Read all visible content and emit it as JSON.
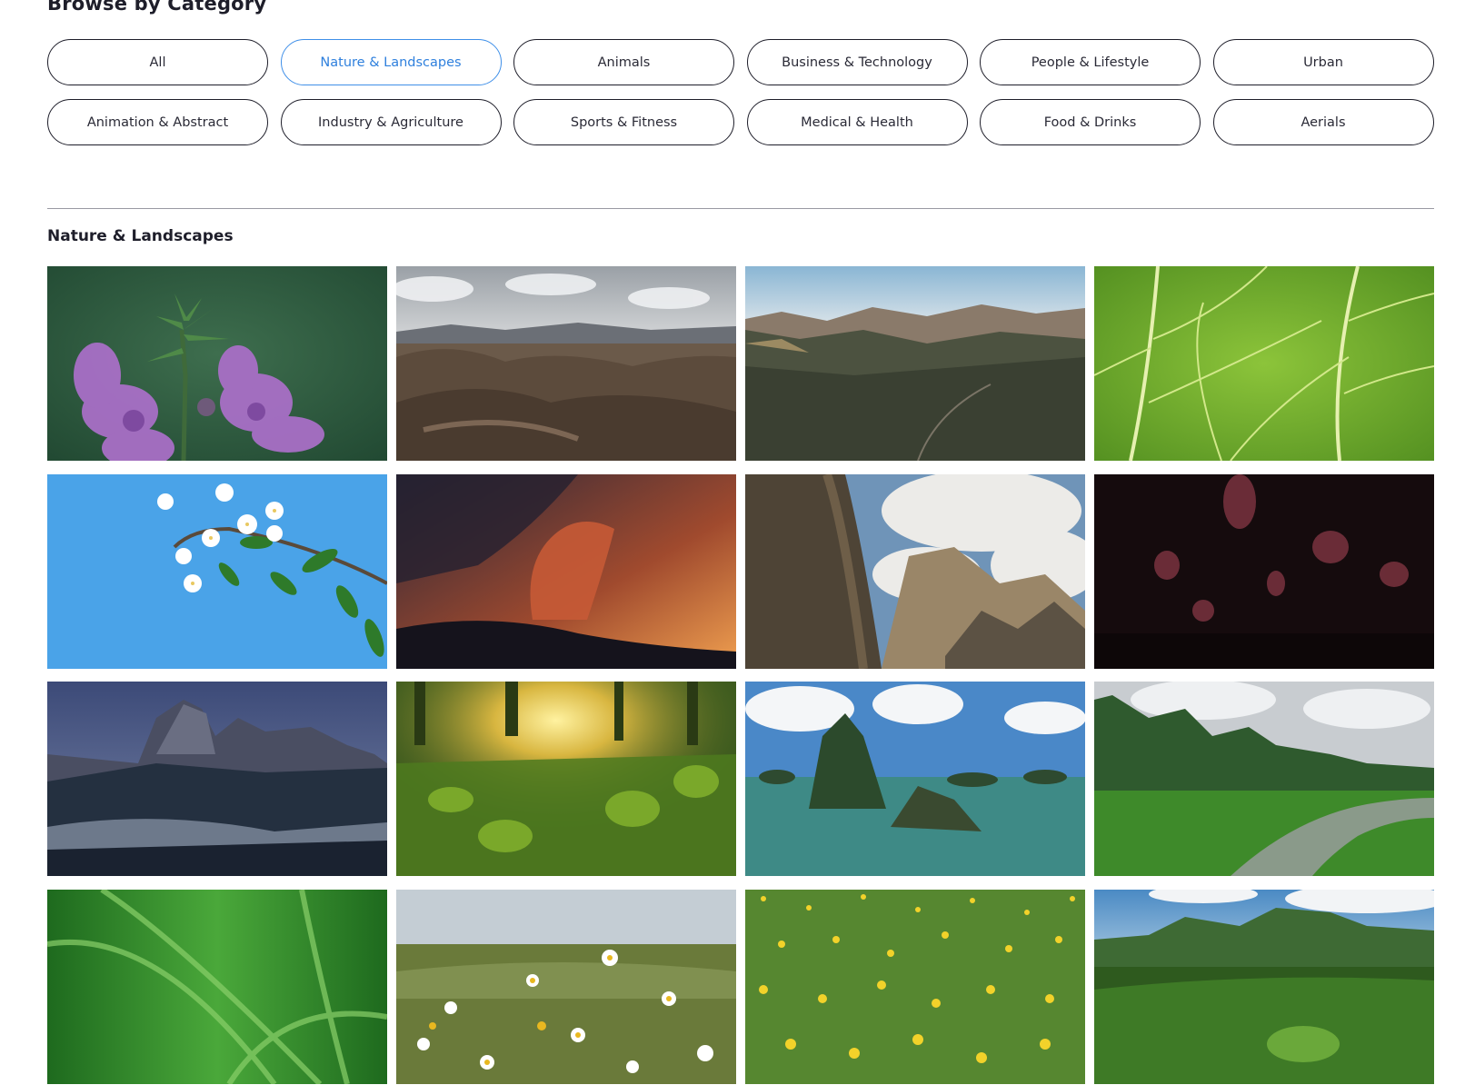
{
  "browse": {
    "heading": "Browse by Category",
    "categories": [
      {
        "label": "All"
      },
      {
        "label": "Nature & Landscapes",
        "active": true
      },
      {
        "label": "Animals"
      },
      {
        "label": "Business & Technology"
      },
      {
        "label": "People & Lifestyle"
      },
      {
        "label": "Urban"
      },
      {
        "label": "Animation & Abstract"
      },
      {
        "label": "Industry & Agriculture"
      },
      {
        "label": "Sports & Fitness"
      },
      {
        "label": "Medical & Health"
      },
      {
        "label": "Food & Drinks"
      },
      {
        "label": "Aerials"
      }
    ]
  },
  "section": {
    "title": "Nature & Landscapes"
  },
  "colors": {
    "accent": "#3f8fe8",
    "text": "#1e1e2a",
    "divider": "#9a9aa2"
  },
  "thumbnails": [
    {
      "name": "purple-flower-thumbnail"
    },
    {
      "name": "desert-rocks-thumbnail"
    },
    {
      "name": "mountain-valley-thumbnail"
    },
    {
      "name": "green-leaf-thumbnail"
    },
    {
      "name": "cherry-blossom-thumbnail"
    },
    {
      "name": "volcano-eruption-thumbnail"
    },
    {
      "name": "cloudy-cliffs-thumbnail"
    },
    {
      "name": "aurora-night-thumbnail"
    },
    {
      "name": "snowy-mountain-thumbnail"
    },
    {
      "name": "forest-sunlight-thumbnail"
    },
    {
      "name": "sea-islands-thumbnail"
    },
    {
      "name": "river-jungle-thumbnail"
    },
    {
      "name": "grass-blades-thumbnail"
    },
    {
      "name": "daisy-field-thumbnail"
    },
    {
      "name": "dandelion-meadow-thumbnail"
    },
    {
      "name": "green-hills-thumbnail"
    }
  ]
}
